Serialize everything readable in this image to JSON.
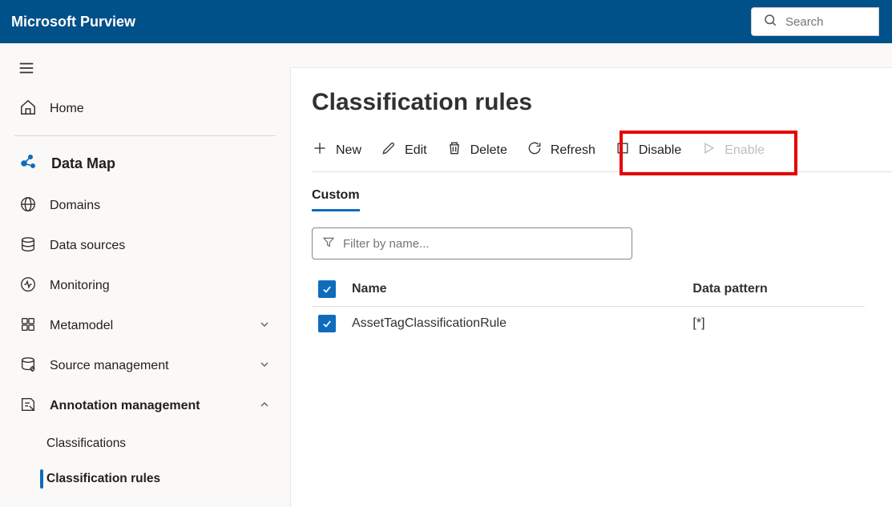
{
  "brand": "Microsoft Purview",
  "search": {
    "placeholder": "Search"
  },
  "sidebar": {
    "home": "Home",
    "section_title": "Data Map",
    "items": [
      {
        "label": "Domains"
      },
      {
        "label": "Data sources"
      },
      {
        "label": "Monitoring"
      },
      {
        "label": "Metamodel"
      },
      {
        "label": "Source management"
      },
      {
        "label": "Annotation management"
      }
    ],
    "annotation_children": [
      {
        "label": "Classifications"
      },
      {
        "label": "Classification rules"
      }
    ]
  },
  "main": {
    "title": "Classification rules",
    "cmd_new": "New",
    "cmd_edit": "Edit",
    "cmd_delete": "Delete",
    "cmd_refresh": "Refresh",
    "cmd_disable": "Disable",
    "cmd_enable": "Enable",
    "tab_custom": "Custom",
    "filter_placeholder": "Filter by name...",
    "columns": {
      "name": "Name",
      "pattern": "Data pattern"
    },
    "rows": [
      {
        "name": "AssetTagClassificationRule",
        "pattern": "[*]"
      }
    ]
  }
}
